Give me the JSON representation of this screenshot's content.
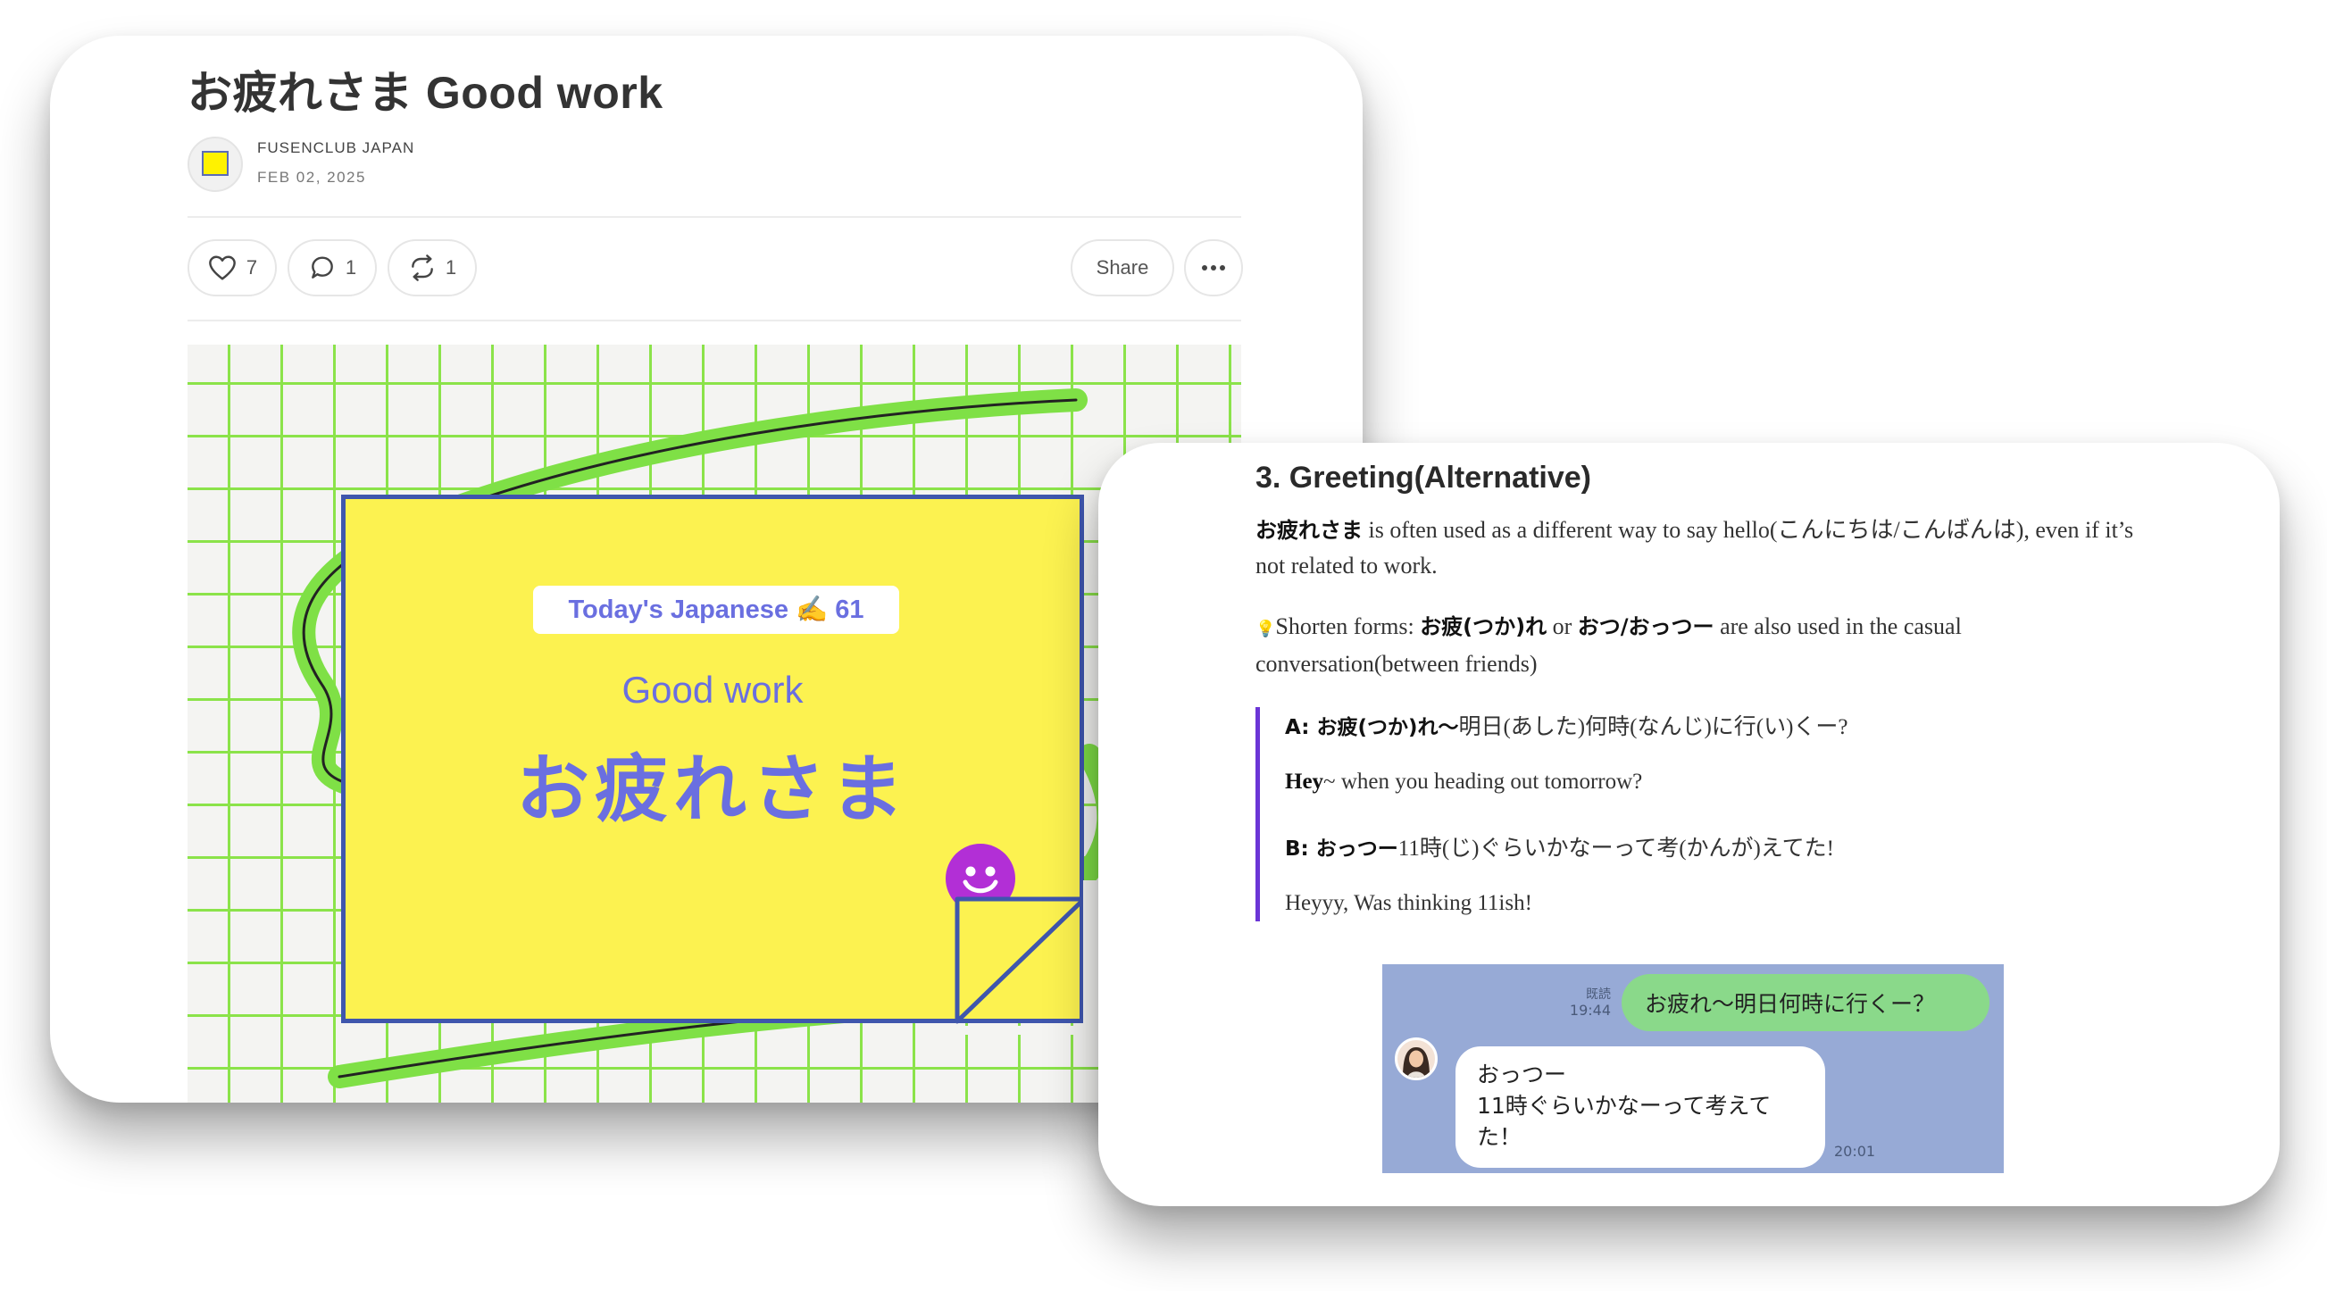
{
  "post": {
    "title": "お疲れさま Good work",
    "author": "FUSENCLUB JAPAN",
    "date": "FEB 02, 2025",
    "actions": {
      "like_count": "7",
      "comment_count": "1",
      "restack_count": "1",
      "share_label": "Share"
    },
    "hero": {
      "tag": "Today's Japanese ✍️ 61",
      "english": "Good work",
      "japanese": "お疲れさま"
    }
  },
  "article": {
    "heading": "3. Greeting(Alternative)",
    "para1": {
      "term": "お疲れさま",
      "text": " is often used as a different way to say hello(こんにちは/こんばんは), even if it’s not related to work."
    },
    "para2": {
      "icon": "💡",
      "prefix": "Shorten forms: ",
      "term1": "お疲(つか)れ",
      "joiner": " or ",
      "term2": "おつ/おっつー",
      "suffix": " are also used in the casual conversation(between friends)"
    },
    "dialogue": [
      {
        "speaker": "A: ",
        "jp_bold": "お疲(つか)れ〜",
        "jp_rest": "明日(あした)何時(なんじ)に行(い)くー?"
      },
      {
        "en_bold": "Hey",
        "en_rest": "~ when you heading out tomorrow?"
      },
      {
        "speaker": "B: ",
        "jp_bold": "おっつー",
        "jp_rest": "11時(じ)ぐらいかなーって考(かんが)えてた!"
      },
      {
        "en_rest": "Heyyy, Was thinking 11ish!"
      }
    ],
    "chat": {
      "read_label": "既読",
      "sent_time": "19:44",
      "sent_message": "お疲れ〜明日何時に行くー？",
      "reply_lines": [
        "おっつー",
        "11時ぐらいかなーって考えて",
        "た！"
      ],
      "reply_time": "20:01"
    }
  },
  "colors": {
    "grid_green": "#8be34a",
    "sticky_yellow": "#fcf250",
    "accent_purple": "#6a6fe0",
    "quote_bar": "#6b35d6",
    "chat_bg": "#97aad6",
    "bubble_green": "#8ad98a"
  },
  "icons": [
    "heart-icon",
    "comment-icon",
    "restack-icon",
    "more-icon",
    "smiley-icon",
    "lightbulb-icon",
    "avatar"
  ]
}
